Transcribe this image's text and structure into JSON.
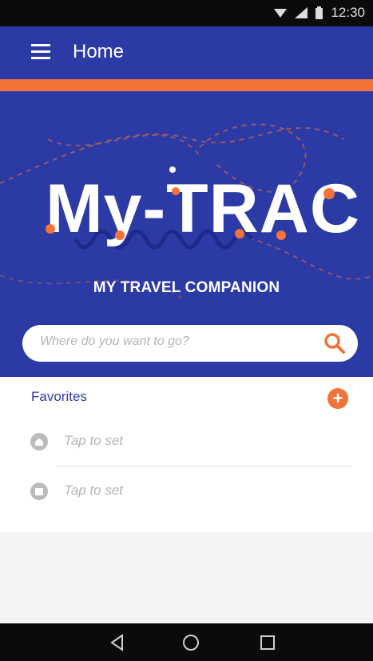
{
  "status_bar": {
    "time": "12:30"
  },
  "appbar": {
    "title": "Home"
  },
  "hero": {
    "logo_text": "My-TRAC",
    "tagline": "MY TRAVEL COMPANION",
    "search": {
      "placeholder": "Where do you want to go?"
    }
  },
  "favorites": {
    "title": "Favorites",
    "items": [
      {
        "label": "Tap to set",
        "icon": "home-icon"
      },
      {
        "label": "Tap to set",
        "icon": "work-icon"
      }
    ]
  },
  "colors": {
    "primary": "#2b3aa5",
    "accent": "#f2723a"
  }
}
